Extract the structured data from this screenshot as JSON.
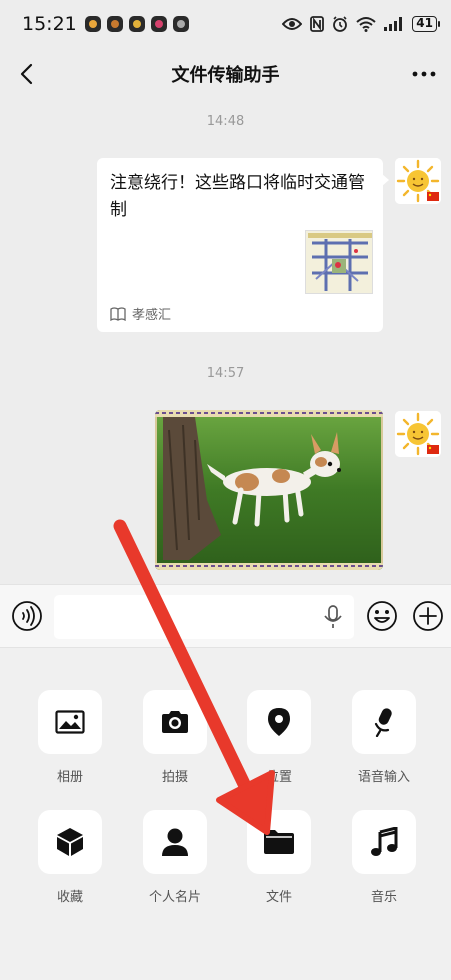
{
  "status_bar": {
    "time": "15:21",
    "battery": "41",
    "app_icons": [
      "app-1",
      "app-2",
      "app-3",
      "app-4",
      "app-5"
    ],
    "indicators": [
      "eye-icon",
      "nfc-icon",
      "alarm-icon",
      "wifi-icon",
      "signal-icon"
    ]
  },
  "nav": {
    "title": "文件传输助手",
    "back_icon": "chevron-left-icon",
    "more_icon": "more-dots-icon"
  },
  "messages": [
    {
      "timestamp": "14:48",
      "type": "article",
      "title": "注意绕行！这些路口将临时交通管制",
      "source": "孝感汇"
    },
    {
      "timestamp": "14:57",
      "type": "image"
    }
  ],
  "input_bar": {
    "value": "",
    "voice_icon": "voice-icon",
    "mic_icon": "mic-icon",
    "emoji_icon": "emoji-icon",
    "plus_icon": "plus-icon"
  },
  "panel": {
    "items": [
      {
        "label": "相册",
        "icon": "album-icon"
      },
      {
        "label": "拍摄",
        "icon": "camera-icon"
      },
      {
        "label": "位置",
        "icon": "location-icon"
      },
      {
        "label": "语音输入",
        "icon": "voice-input-icon"
      },
      {
        "label": "收藏",
        "icon": "favorites-icon"
      },
      {
        "label": "个人名片",
        "icon": "contact-card-icon"
      },
      {
        "label": "文件",
        "icon": "folder-icon"
      },
      {
        "label": "音乐",
        "icon": "music-icon"
      }
    ]
  },
  "colors": {
    "background": "#ededed",
    "panel": "#f0f0f0",
    "arrow": "#e8392b",
    "timestamp": "#999999"
  }
}
